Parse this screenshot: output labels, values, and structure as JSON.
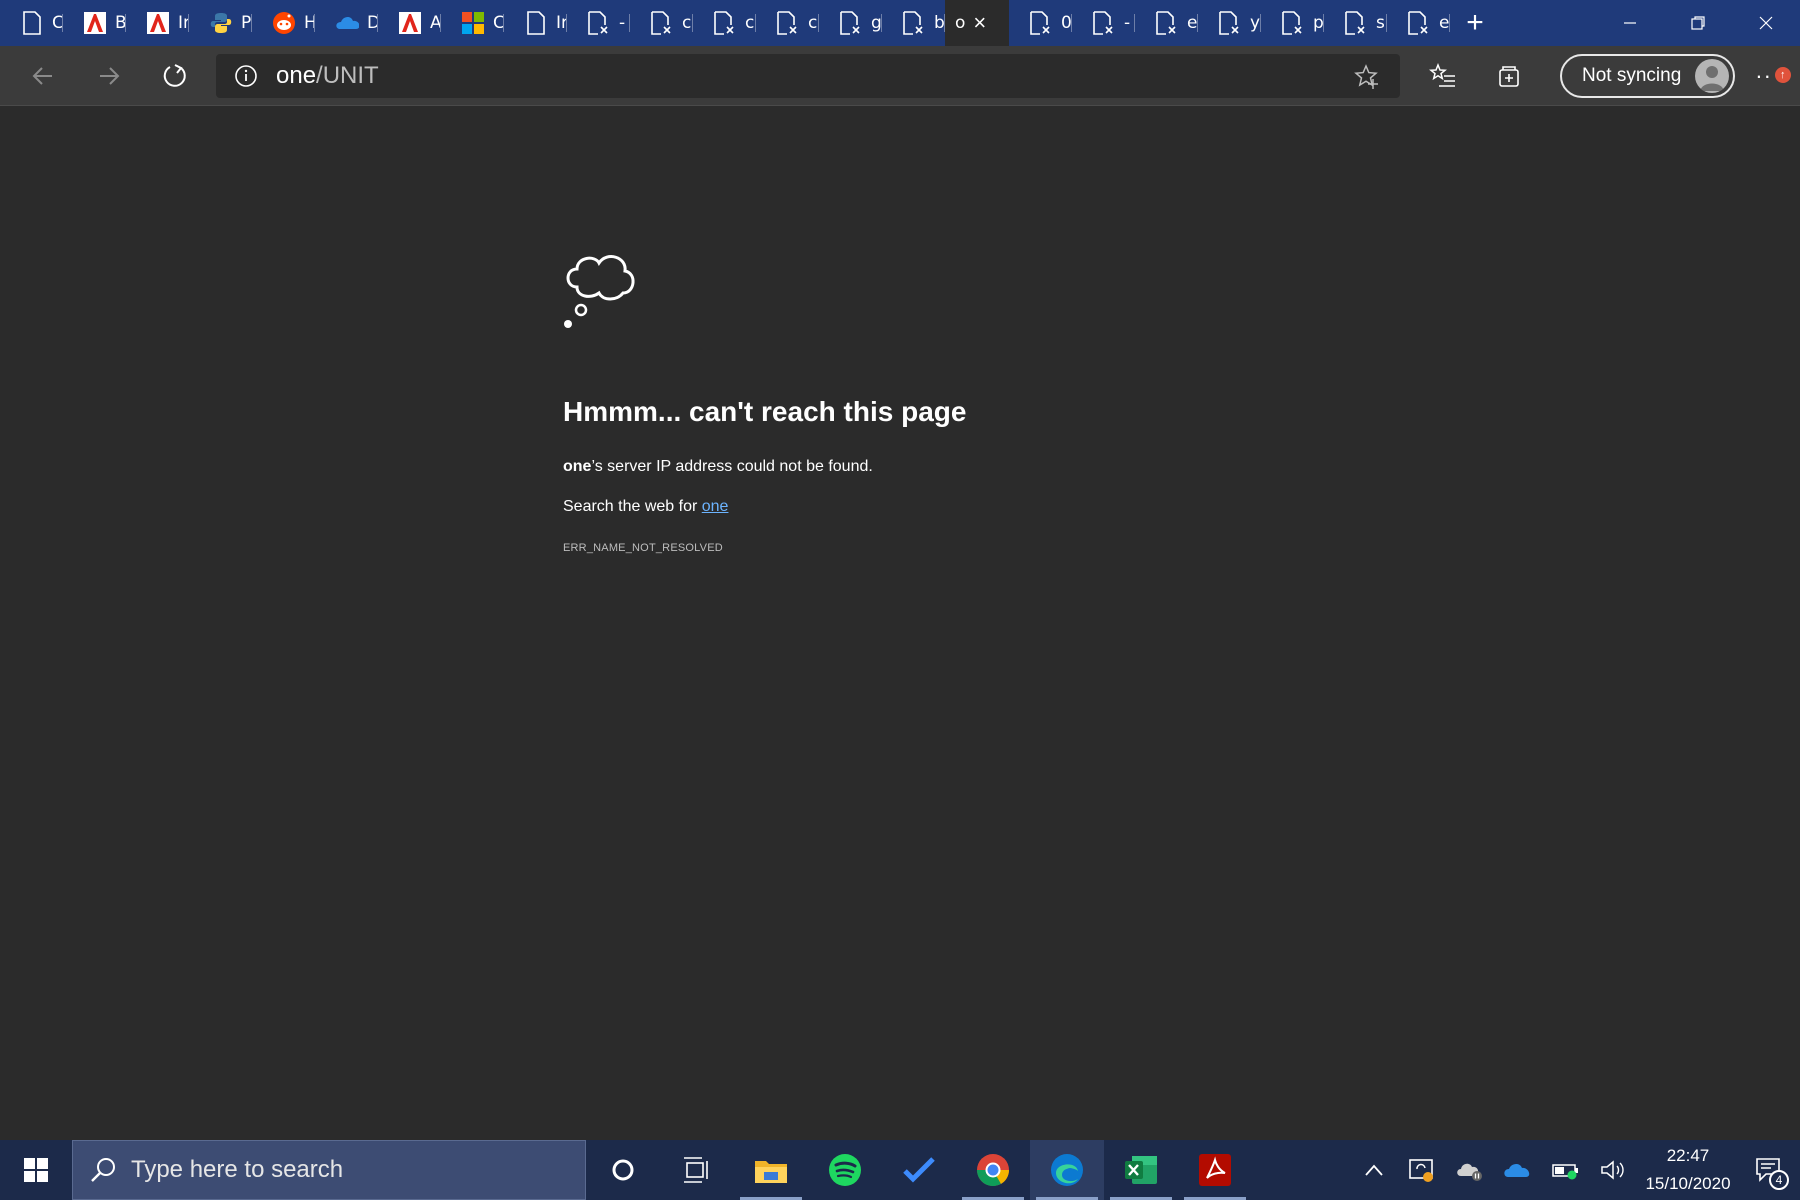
{
  "tabs": [
    {
      "label": "C",
      "icon": "page-icon"
    },
    {
      "label": "B",
      "icon": "adobe-icon"
    },
    {
      "label": "Ir",
      "icon": "adobe-icon"
    },
    {
      "label": "P",
      "icon": "python-icon"
    },
    {
      "label": "H",
      "icon": "reddit-icon"
    },
    {
      "label": "D",
      "icon": "onedrive-icon"
    },
    {
      "label": "A",
      "icon": "adobe-icon"
    },
    {
      "label": "C",
      "icon": "microsoft-icon"
    },
    {
      "label": "Ir",
      "icon": "page-icon"
    },
    {
      "label": "-",
      "icon": "broken-page-icon"
    },
    {
      "label": "c",
      "icon": "broken-page-icon"
    },
    {
      "label": "c",
      "icon": "broken-page-icon"
    },
    {
      "label": "c",
      "icon": "broken-page-icon"
    },
    {
      "label": "g",
      "icon": "broken-page-icon"
    },
    {
      "label": "b",
      "icon": "broken-page-icon"
    },
    {
      "label": "o",
      "icon": "none",
      "active": true
    },
    {
      "label": "0",
      "icon": "broken-page-icon"
    },
    {
      "label": "-",
      "icon": "broken-page-icon"
    },
    {
      "label": "e",
      "icon": "broken-page-icon"
    },
    {
      "label": "y",
      "icon": "broken-page-icon"
    },
    {
      "label": "p",
      "icon": "broken-page-icon"
    },
    {
      "label": "s",
      "icon": "broken-page-icon"
    },
    {
      "label": "e",
      "icon": "broken-page-icon"
    }
  ],
  "address": {
    "host": "one",
    "path": "/UNIT"
  },
  "profile": {
    "sync_label": "Not syncing"
  },
  "error": {
    "title": "Hmmm... can't reach this page",
    "host_bold": "one",
    "message_rest": "’s server IP address could not be found.",
    "search_prefix": "Search the web for ",
    "search_link": "one",
    "code": "ERR_NAME_NOT_RESOLVED"
  },
  "taskbar": {
    "search_placeholder": "Type here to search",
    "apps": [
      "cortana-icon",
      "task-view-icon",
      "file-explorer-icon",
      "spotify-icon",
      "todo-icon",
      "chrome-icon",
      "edge-icon",
      "excel-icon",
      "acrobat-icon"
    ],
    "time": "22:47",
    "date": "15/10/2020",
    "notification_count": "4"
  },
  "colors": {
    "titlebar": "#1f3a7a",
    "toolbar": "#3b3b3b",
    "page": "#2b2b2b",
    "link": "#6cb4ff",
    "taskbar": "#1c2a4a"
  }
}
